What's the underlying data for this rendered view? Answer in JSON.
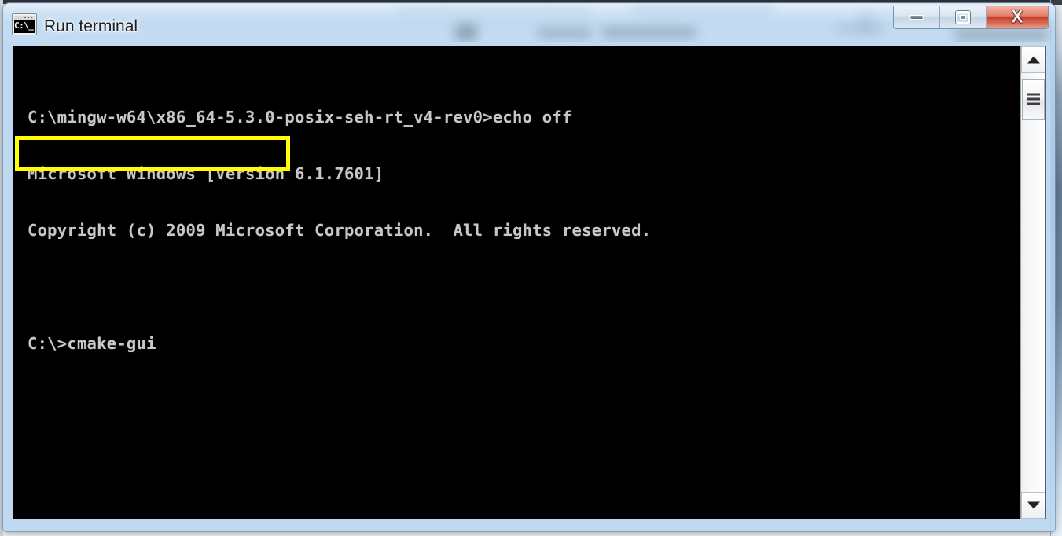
{
  "window": {
    "title": "Run terminal",
    "icon": "console-icon",
    "icon_prompt": "C:\\_",
    "controls": {
      "minimize_label": "Minimize",
      "maximize_label": "Restore",
      "close_label": "X",
      "close_color": "#c6402c",
      "frame_color": "#b7d5f1"
    }
  },
  "console": {
    "background": "#000000",
    "text_color": "#c8c8c8",
    "lines": [
      "C:\\mingw-w64\\x86_64-5.3.0-posix-seh-rt_v4-rev0>echo off",
      "Microsoft Windows [Version 6.1.7601]",
      "Copyright (c) 2009 Microsoft Corporation.  All rights reserved.",
      "",
      "C:\\>cmake-gui"
    ],
    "highlighted_line": "C:\\>cmake-gui",
    "annotation_color": "#ffff00"
  },
  "scrollbar": {
    "up_arrow": "scroll-up-arrow",
    "down_arrow": "scroll-down-arrow",
    "thumb": "scroll-thumb"
  }
}
